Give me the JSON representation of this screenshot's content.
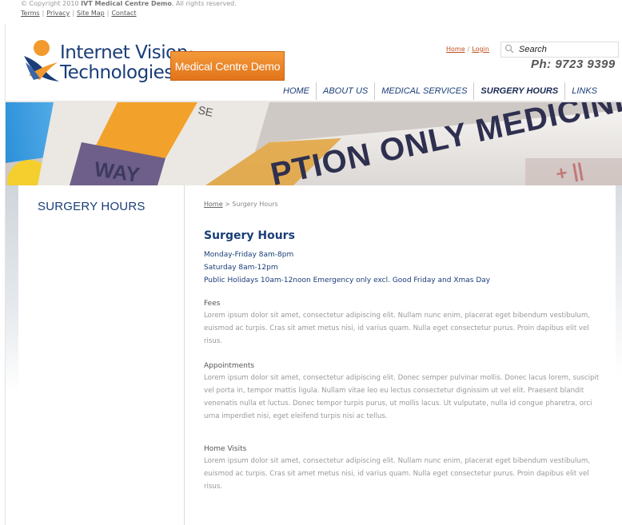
{
  "footer": {
    "copyright_prefix": "© Copyright 2010 ",
    "copyright_bold": "IVT Medical Centre Demo",
    "copyright_suffix": ", All rights reserved.",
    "links": [
      "Terms",
      "Privacy",
      "Site Map",
      "Contact"
    ]
  },
  "header": {
    "logo_line1": "Internet Vision",
    "logo_reg": "®",
    "logo_line2": "Technologies",
    "badge": "Medical Centre Demo",
    "top_links": [
      "Home",
      "Login"
    ],
    "top_links_sep": "/",
    "search_placeholder": "Search",
    "phone": "Ph: 9723 9399"
  },
  "nav": {
    "items": [
      "HOME",
      "ABOUT US",
      "MEDICAL SERVICES",
      "SURGERY HOURS",
      "LINKS"
    ],
    "active": "SURGERY HOURS"
  },
  "banner": {
    "text_main": "PTION ONLY MEDICINE",
    "text_small": "SE",
    "text_box": "WAY"
  },
  "sidebar": {
    "title": "SURGERY HOURS"
  },
  "main": {
    "breadcrumb_home": "Home",
    "breadcrumb_sep": " > ",
    "breadcrumb_current": "Surgery Hours",
    "title": "Surgery Hours",
    "hours": [
      "Monday-Friday 8am-8pm",
      "Saturday 8am-12pm",
      "Public Holidays 10am-12noon Emergency only excl. Good Friday and Xmas Day"
    ],
    "sections": [
      {
        "title": "Fees",
        "body": "Lorem ipsum dolor sit amet, consectetur adipiscing elit. Nullam nunc enim, placerat eget bibendum vestibulum, euismod ac turpis. Cras sit amet metus nisi, id varius quam. Nulla eget consectetur purus. Proin dapibus elit vel risus."
      },
      {
        "title": "Appointments",
        "body": "Lorem ipsum dolor sit amet, consectetur adipiscing elit. Donec semper pulvinar mollis. Donec lacus lorem, suscipit vel porta in, tempor mattis ligula. Nullam vitae leo eu lectus consectetur dignissim ut vel elit. Praesent blandit venenatis nulla et luctus. Donec tempor turpis purus, ut mollis lacus. Ut vulputate, nulla id congue pharetra, orci urna imperdiet nisi, eget eleifend turpis nisi ac tellus."
      },
      {
        "title": "Home Visits",
        "body": "Lorem ipsum dolor sit amet, consectetur adipiscing elit. Nullam nunc enim, placerat eget bibendum vestibulum, euismod ac turpis. Cras sit amet metus nisi, id varius quam. Nulla eget consectetur purus. Proin dapibus elit vel risus."
      }
    ]
  },
  "colors": {
    "brand_blue": "#1a3d78",
    "accent_orange": "#e8822a"
  }
}
